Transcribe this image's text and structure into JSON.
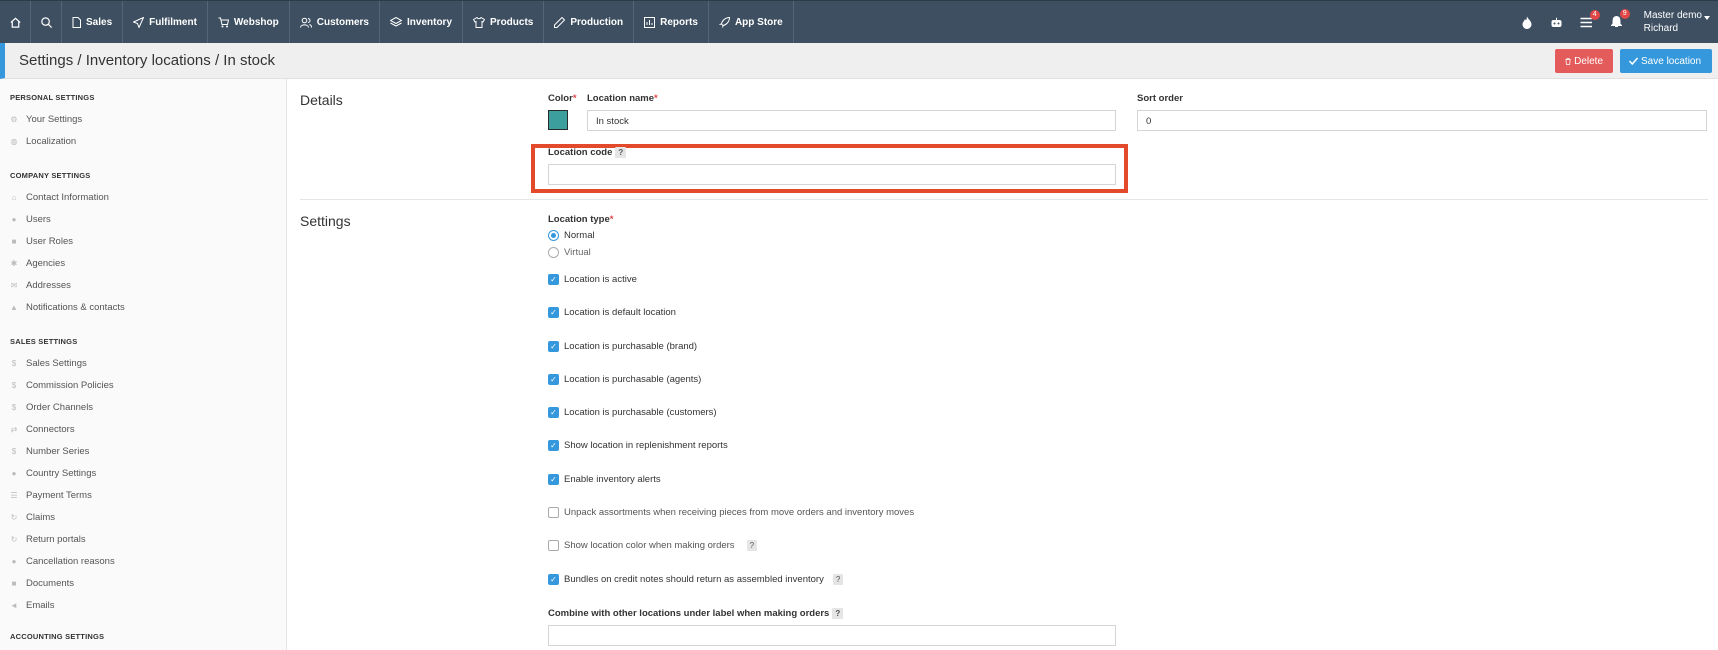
{
  "nav": {
    "items": [
      {
        "label": "Sales",
        "icon": "document-icon"
      },
      {
        "label": "Fulfilment",
        "icon": "send-icon"
      },
      {
        "label": "Webshop",
        "icon": "cart-icon"
      },
      {
        "label": "Customers",
        "icon": "users-icon"
      },
      {
        "label": "Inventory",
        "icon": "layers-icon"
      },
      {
        "label": "Products",
        "icon": "shirt-icon"
      },
      {
        "label": "Production",
        "icon": "pencil-icon"
      },
      {
        "label": "Reports",
        "icon": "report-icon"
      },
      {
        "label": "App Store",
        "icon": "rocket-icon"
      }
    ],
    "badges": {
      "list": "4",
      "bell": "9"
    },
    "user_line1": "Master demo",
    "user_line2": "Richard"
  },
  "header": {
    "title": "Settings / Inventory locations / In stock",
    "delete_label": "Delete",
    "save_label": "Save location"
  },
  "sidebar": {
    "personal_heading": "PERSONAL SETTINGS",
    "personal": [
      "Your Settings",
      "Localization"
    ],
    "company_heading": "COMPANY SETTINGS",
    "company": [
      "Contact Information",
      "Users",
      "User Roles",
      "Agencies",
      "Addresses",
      "Notifications & contacts"
    ],
    "sales_heading": "SALES SETTINGS",
    "sales": [
      "Sales Settings",
      "Commission Policies",
      "Order Channels",
      "Connectors",
      "Number Series",
      "Country Settings",
      "Payment Terms",
      "Claims",
      "Return portals",
      "Cancellation reasons",
      "Documents",
      "Emails"
    ],
    "accounting_heading": "ACCOUNTING SETTINGS"
  },
  "details": {
    "section_title": "Details",
    "color_label": "Color",
    "color_value": "#3d9f9d",
    "name_label": "Location name",
    "name_value": "In stock",
    "sort_label": "Sort order",
    "sort_value": "0",
    "code_label": "Location code",
    "code_help": "?",
    "code_value": ""
  },
  "settings": {
    "section_title": "Settings",
    "type_label": "Location type",
    "type_options": [
      "Normal",
      "Virtual"
    ],
    "type_selected": "Normal",
    "checks": [
      {
        "label": "Location is active",
        "checked": true
      },
      {
        "label": "Location is default location",
        "checked": true
      },
      {
        "label": "Location is purchasable (brand)",
        "checked": true
      },
      {
        "label": "Location is purchasable (agents)",
        "checked": true
      },
      {
        "label": "Location is purchasable (customers)",
        "checked": true
      },
      {
        "label": "Show location in replenishment reports",
        "checked": true
      },
      {
        "label": "Enable inventory alerts",
        "checked": true
      },
      {
        "label": "Unpack assortments when receiving pieces from move orders and inventory moves",
        "checked": false
      },
      {
        "label": "Show location color when making orders",
        "checked": false,
        "help": "?"
      },
      {
        "label": "Bundles on credit notes should return as assembled inventory",
        "checked": true,
        "help": "?"
      }
    ],
    "combine_label": "Combine with other locations under label when making orders",
    "combine_help": "?",
    "combine_value": ""
  },
  "colors": {
    "nav_bg": "#3d4f61",
    "accent": "#3598dc",
    "danger": "#e35b5a",
    "highlight": "#e3492b"
  }
}
